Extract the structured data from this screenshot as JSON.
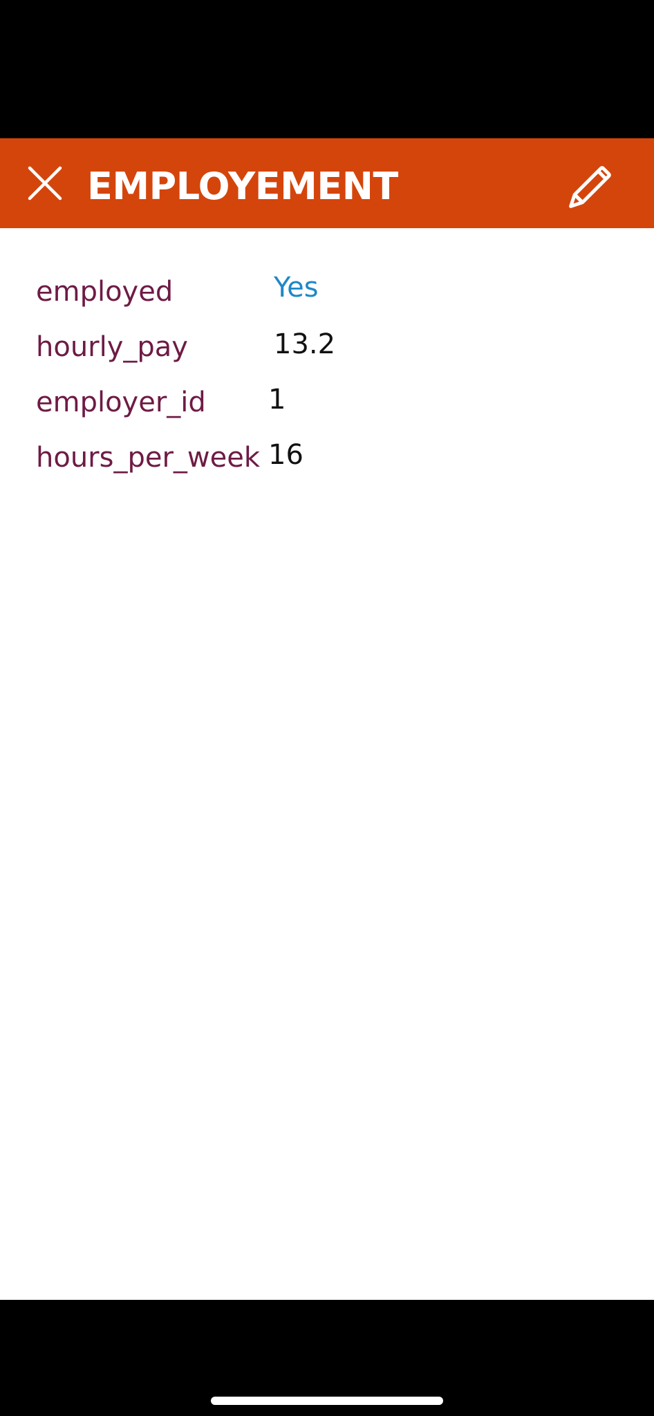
{
  "header": {
    "title": "EMPLOYEMENT",
    "close_icon": "close-icon",
    "edit_icon": "pencil-icon",
    "background_color": "#D4450C"
  },
  "fields": [
    {
      "label": "employed",
      "value": "Yes"
    },
    {
      "label": "hourly_pay",
      "value": "13.2"
    },
    {
      "label": "employer_id",
      "value": "1"
    },
    {
      "label": "hours_per_week",
      "value": "16"
    }
  ],
  "colors": {
    "label": "#6E1B45",
    "link_value": "#1E88C8",
    "value": "#111111"
  }
}
